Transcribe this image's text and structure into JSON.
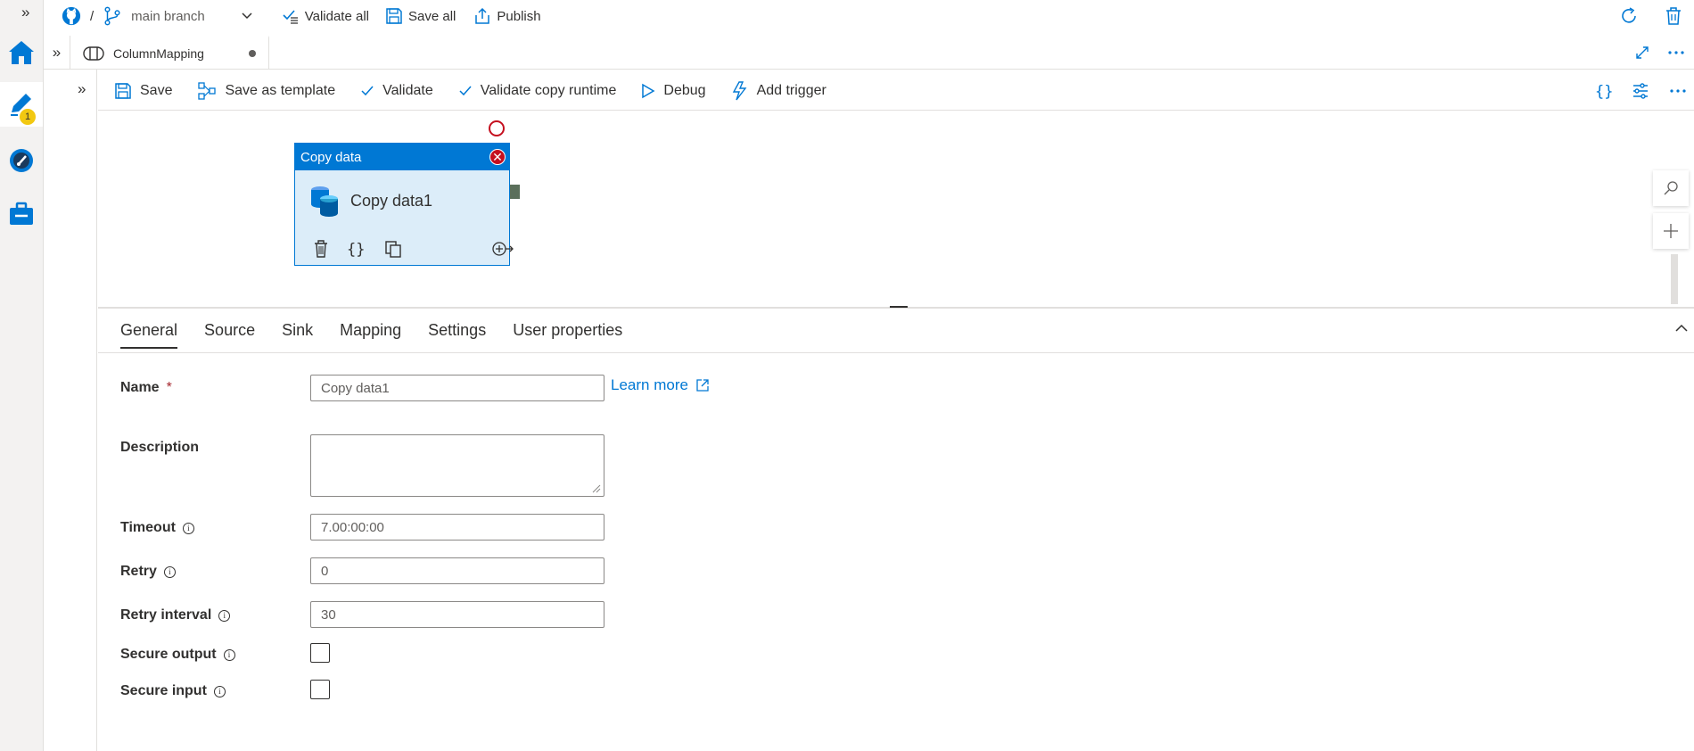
{
  "topbar": {
    "separator": "/",
    "branch": "main branch",
    "validate_all": "Validate all",
    "save_all": "Save all",
    "publish": "Publish"
  },
  "rail": {
    "expand_glyph": "»",
    "author_badge": "1"
  },
  "tab": {
    "title": "ColumnMapping"
  },
  "toolbar": {
    "save": "Save",
    "save_as_template": "Save as template",
    "validate": "Validate",
    "validate_copy_runtime": "Validate copy runtime",
    "debug": "Debug",
    "add_trigger": "Add trigger"
  },
  "activity": {
    "type": "Copy data",
    "name": "Copy data1"
  },
  "properties": {
    "tabs": [
      "General",
      "Source",
      "Sink",
      "Mapping",
      "Settings",
      "User properties"
    ],
    "active_tab": "General",
    "name_label": "Name",
    "required_mark": "*",
    "name_value": "Copy data1",
    "learn_more": "Learn more",
    "description_label": "Description",
    "description_value": "",
    "timeout_label": "Timeout",
    "timeout_value": "7.00:00:00",
    "retry_label": "Retry",
    "retry_value": "0",
    "retry_interval_label": "Retry interval",
    "retry_interval_value": "30",
    "secure_output_label": "Secure output",
    "secure_input_label": "Secure input",
    "secure_output_checked": false,
    "secure_input_checked": false
  },
  "colors": {
    "accent": "#0078d4",
    "error": "#c50f1f",
    "activity_bg": "#dcedf9",
    "badge": "#f2c811"
  }
}
